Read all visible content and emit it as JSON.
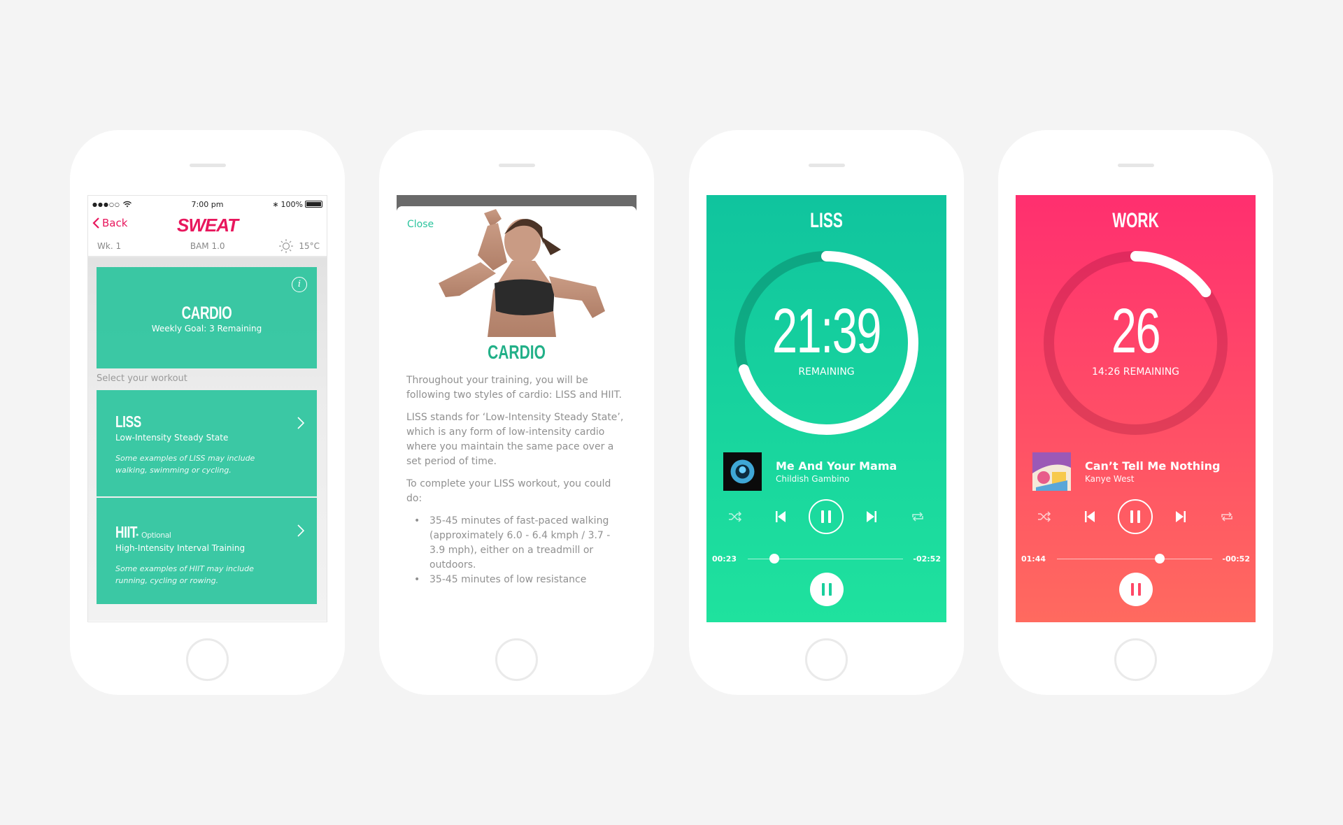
{
  "phone1": {
    "status": {
      "dots": "●●●○○",
      "time": "7:00 pm",
      "bluetooth": "∗",
      "battery": "100%"
    },
    "nav": {
      "back_label": "Back",
      "logo": "SWEAT"
    },
    "subbar": {
      "week": "Wk. 1",
      "program": "BAM 1.0",
      "temperature": "15°C"
    },
    "banner": {
      "title": "CARDIO",
      "subtitle": "Weekly Goal: 3 Remaining",
      "info_glyph": "i"
    },
    "select_label": "Select your workout",
    "workouts": [
      {
        "title": "LISS",
        "optional": "",
        "subtitle": "Low-Intensity Steady State",
        "description": "Some examples of LISS may include walking, swimming or cycling."
      },
      {
        "title": "HIIT",
        "optional": "• Optional",
        "subtitle": "High-Intensity Interval Training",
        "description": "Some examples of HIIT may include running, cycling or rowing."
      }
    ]
  },
  "phone2": {
    "close_label": "Close",
    "title": "CARDIO",
    "paragraphs": [
      "Throughout your training, you will be following two styles of cardio: LISS and HIIT.",
      "LISS stands for ‘Low-Intensity Steady State’, which is any form of low-intensity cardio where you maintain the same pace over a set period of time.",
      "To complete your LISS workout, you could do:"
    ],
    "bullets": [
      "35-45 minutes of fast-paced walking (approximately 6.0 - 6.4 kmph / 3.7 - 3.9 mph), either on a treadmill or outdoors.",
      "35-45 minutes of low resistance"
    ]
  },
  "phone3": {
    "title": "LISS",
    "big": "21:39",
    "small": "REMAINING",
    "ring_progress": 0.7,
    "track": {
      "title": "Me And Your Mama",
      "artist": "Childish Gambino"
    },
    "elapsed": "00:23",
    "remaining": "-02:52",
    "seek_fraction": 0.17,
    "accent": "#19cf9c"
  },
  "phone4": {
    "title": "WORK",
    "big": "26",
    "small": "14:26 REMAINING",
    "ring_progress": 0.15,
    "track": {
      "title": "Can’t Tell Me Nothing",
      "artist": "Kanye West"
    },
    "elapsed": "01:44",
    "remaining": "-00:52",
    "seek_fraction": 0.66,
    "accent": "#ff4766"
  },
  "icons": [
    "chevron-left-icon",
    "wifi-icon",
    "bluetooth-icon",
    "battery-icon",
    "sun-icon",
    "info-icon",
    "chevron-right-icon",
    "shuffle-icon",
    "previous-icon",
    "pause-icon",
    "next-icon",
    "repeat-icon"
  ]
}
